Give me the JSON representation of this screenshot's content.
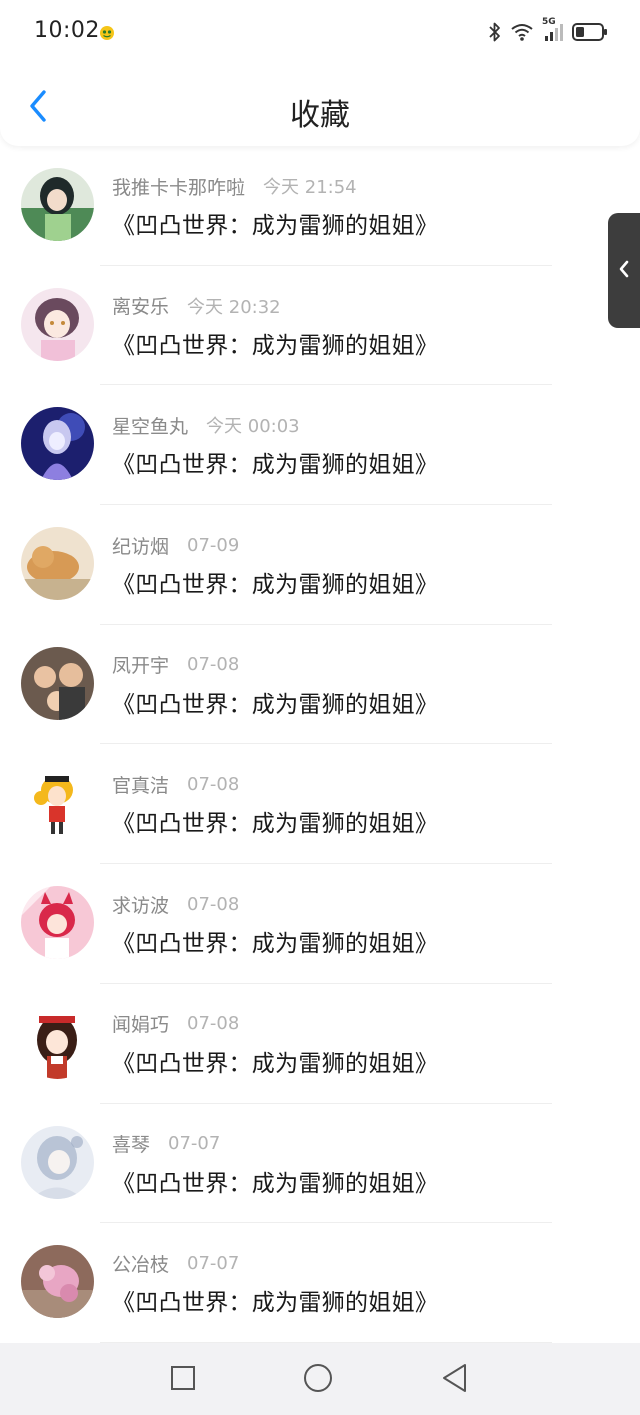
{
  "status_bar": {
    "time": "10:02",
    "network_label": "5G",
    "icons": [
      "emoji-icon",
      "bluetooth-icon",
      "wifi-icon",
      "signal-icon",
      "battery-icon"
    ]
  },
  "header": {
    "title": "收藏",
    "back_icon": "chevron-left-icon",
    "accent_color": "#1a8cff"
  },
  "items": [
    {
      "user": "我推卡卡那咋啦",
      "time": "今天 21:54",
      "title": "《凹凸世界：成为雷狮的姐姐》",
      "avatar_color": "#5b7a5a"
    },
    {
      "user": "离安乐",
      "time": "今天 20:32",
      "title": "《凹凸世界：成为雷狮的姐姐》",
      "avatar_color": "#e9c6d8"
    },
    {
      "user": "星空鱼丸",
      "time": "今天 00:03",
      "title": "《凹凸世界：成为雷狮的姐姐》",
      "avatar_color": "#2b2f8c"
    },
    {
      "user": "纪访烟",
      "time": "07-09",
      "title": "《凹凸世界：成为雷狮的姐姐》",
      "avatar_color": "#d9b48a"
    },
    {
      "user": "凤开宇",
      "time": "07-08",
      "title": "《凹凸世界：成为雷狮的姐姐》",
      "avatar_color": "#7d6a5a"
    },
    {
      "user": "官真洁",
      "time": "07-08",
      "title": "《凹凸世界：成为雷狮的姐姐》",
      "avatar_color": "#f4c430"
    },
    {
      "user": "求访波",
      "time": "07-08",
      "title": "《凹凸世界：成为雷狮的姐姐》",
      "avatar_color": "#f2a0b8"
    },
    {
      "user": "闻娟巧",
      "time": "07-08",
      "title": "《凹凸世界：成为雷狮的姐姐》",
      "avatar_color": "#b5402c"
    },
    {
      "user": "喜琴",
      "time": "07-07",
      "title": "《凹凸世界：成为雷狮的姐姐》",
      "avatar_color": "#c9d3e4"
    },
    {
      "user": "公冶枝",
      "time": "07-07",
      "title": "《凹凸世界：成为雷狮的姐姐》",
      "avatar_color": "#a86a70"
    }
  ],
  "side_tab": {
    "icon": "chevron-left-icon"
  },
  "nav_bar": {
    "icons": [
      "square-recent-icon",
      "circle-home-icon",
      "triangle-back-icon"
    ]
  }
}
